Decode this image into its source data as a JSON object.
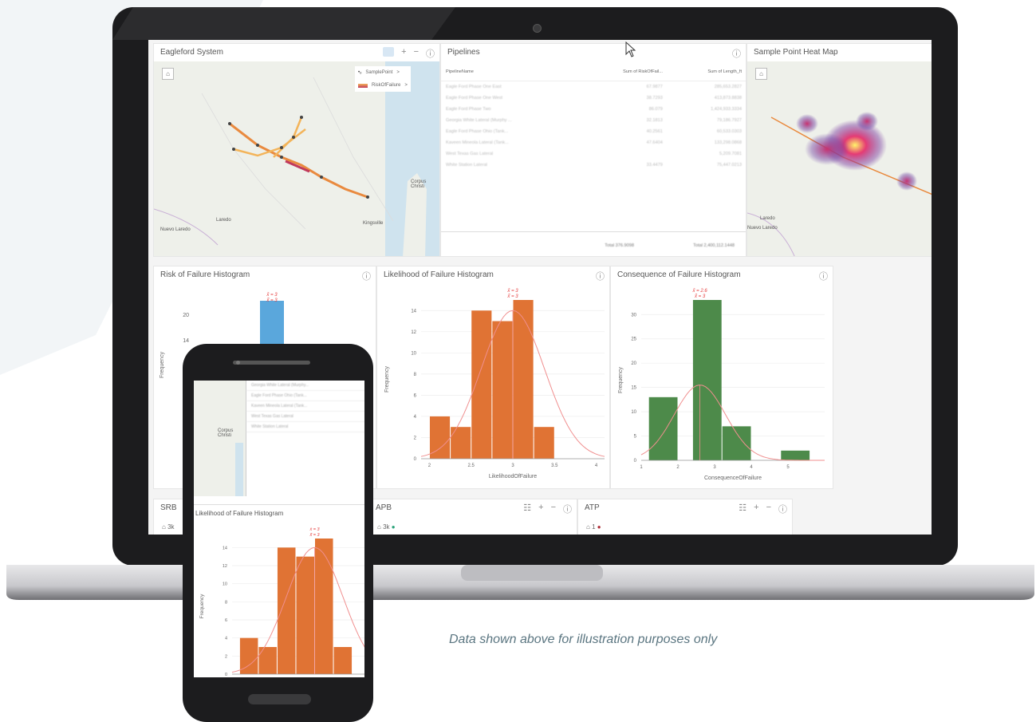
{
  "colors": {
    "orange": "#e07334",
    "green": "#4d8a4a",
    "blue": "#5aa7dc",
    "accent": "#2b7bc7"
  },
  "dashboard": {
    "eagleford": {
      "title": "Eagleford System",
      "legend": [
        "SamplePoint",
        "RiskOfFailure"
      ],
      "places": [
        "Laredo",
        "Nuevo Laredo",
        "Kingsville",
        "Corpus Christi"
      ]
    },
    "pipelines": {
      "title": "Pipelines",
      "columns": [
        "PipelineName",
        "Sum of RiskOfFail...",
        "Sum of Length_ft"
      ],
      "rows": [
        [
          "Eagle Ford Phase One East",
          "67.9877",
          "285,653.2827"
        ],
        [
          "Eagle Ford Phase One West",
          "38.7293",
          "413,873.8838"
        ],
        [
          "Eagle Ford Phase Two",
          "86.079",
          "1,424,933.3334"
        ],
        [
          "Georgia White Lateral (Murphy ...",
          "32.1813",
          "79,186.7927"
        ],
        [
          "Eagle Ford Phase Ohio (Tank...",
          "40.2561",
          "60,533.0303"
        ],
        [
          "Kaveen Mineola Lateral (Tank...",
          "47.6404",
          "133,298.0868"
        ],
        [
          "West Texas Gas Lateral",
          "",
          "5,209.7081"
        ],
        [
          "White Station Lateral",
          "33.4479",
          "75,447.0213"
        ]
      ],
      "total_risk": "Total 376.9098",
      "total_length": "Total 2,400,112.1448"
    },
    "heatmap": {
      "title": "Sample Point Heat Map",
      "places": [
        "Laredo",
        "Nuevo Laredo"
      ]
    },
    "risk_hist": {
      "title": "Risk of Failure Histogram",
      "ylabel": "Frequency",
      "yticks": [
        "20",
        "14"
      ],
      "annot": [
        "x̄ = 3",
        "x̃ = 3"
      ]
    },
    "likelihood_hist": {
      "title": "Likelihood of Failure Histogram",
      "ylabel": "Frequency",
      "xlabel": "LikelihoodOfFailure",
      "annot": [
        "x̄ = 3",
        "x̃ = 3"
      ]
    },
    "consequence_hist": {
      "title": "Consequence of Failure Histogram",
      "ylabel": "Frequency",
      "xlabel": "ConsequenceOfFailure",
      "annot": [
        "x̄ = 2.6",
        "x̃ = 3"
      ]
    },
    "bottom_cards": [
      "SRB",
      "APB",
      "ATP"
    ],
    "bottom_values": [
      "3k",
      "1"
    ]
  },
  "phone": {
    "title": "Likelihood of Failure Histogram",
    "ylabel": "Frequency",
    "annot": [
      "x̄ = 3",
      "x̃ = 3"
    ],
    "rows": [
      "Georgia White Lateral (Murphy...",
      "Eagle Ford Phase Ohio (Tank...",
      "Kaveen Mineola Lateral (Tank...",
      "West Texas Gas Lateral",
      "White Station Lateral"
    ],
    "places": [
      "Corpus Christi"
    ]
  },
  "caption": "Data shown above for illustration purposes only",
  "chart_data": [
    {
      "type": "bar",
      "title": "Likelihood of Failure Histogram",
      "xlabel": "LikelihoodOfFailure",
      "ylabel": "Frequency",
      "x": [
        2.0,
        2.25,
        2.5,
        2.75,
        3.0,
        3.25,
        3.5,
        3.75
      ],
      "bin_width": 0.25,
      "values": [
        4,
        3,
        14,
        13,
        15,
        3
      ],
      "bins": [
        [
          2.0,
          2.25
        ],
        [
          2.25,
          2.5
        ],
        [
          2.5,
          2.75
        ],
        [
          2.75,
          3.0
        ],
        [
          3.0,
          3.25
        ],
        [
          3.25,
          3.5
        ]
      ],
      "xticks": [
        "2",
        "2.5",
        "3",
        "3.5",
        "4"
      ],
      "yticks": [
        "0",
        "2",
        "4",
        "6",
        "8",
        "10",
        "12",
        "14"
      ],
      "ylim": [
        0,
        15
      ],
      "xlim": [
        1.9,
        4.1
      ],
      "mean": "x̄ = 3",
      "median": "x̃ = 3"
    },
    {
      "type": "bar",
      "title": "Consequence of Failure Histogram",
      "xlabel": "ConsequenceOfFailure",
      "ylabel": "Frequency",
      "values": [
        13,
        33,
        7,
        0,
        2
      ],
      "bins": [
        [
          1.2,
          2.0
        ],
        [
          2.4,
          3.2
        ],
        [
          3.2,
          4.0
        ],
        [
          4.0,
          4.8
        ],
        [
          4.8,
          5.6
        ]
      ],
      "xticks": [
        "1",
        "2",
        "3",
        "4",
        "5"
      ],
      "yticks": [
        "0",
        "5",
        "10",
        "15",
        "20",
        "25",
        "30"
      ],
      "ylim": [
        0,
        33
      ],
      "xlim": [
        1,
        6
      ],
      "mean": "x̄ = 2.6",
      "median": "x̃ = 3"
    },
    {
      "type": "bar",
      "title": "Risk of Failure Histogram",
      "ylabel": "Frequency",
      "values": [
        22
      ],
      "yticks": [
        "20",
        "14"
      ]
    }
  ]
}
